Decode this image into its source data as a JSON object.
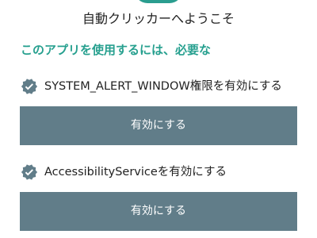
{
  "header": {
    "title": "自動クリッカーへようこそ",
    "subtitle": "このアプリを使用するには、必要な"
  },
  "permissions": [
    {
      "label": "SYSTEM_ALERT_WINDOW権限を有効にする",
      "button_label": "有効にする",
      "icon": "verified-badge-icon"
    },
    {
      "label": "AccessibilityServiceを有効にする",
      "button_label": "有効にする",
      "icon": "verified-badge-icon"
    }
  ],
  "colors": {
    "accent": "#27a08f",
    "button_bg": "#617d89",
    "badge": "#617d89",
    "text": "#222222"
  }
}
